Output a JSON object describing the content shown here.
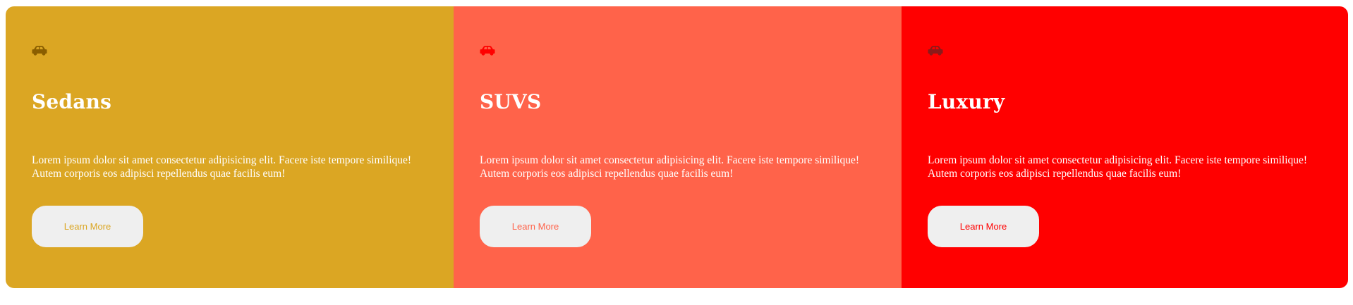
{
  "cards": [
    {
      "title": "Sedans",
      "description": "Lorem ipsum dolor sit amet consectetur adipisicing elit. Facere iste tempore similique! Autem corporis eos adipisci repellendus quae facilis eum!",
      "button_label": "Learn More",
      "icon": "car-icon",
      "background_color": "#DBA623",
      "icon_color": "#8A5E00",
      "button_text_color": "#DBA623"
    },
    {
      "title": "SUVS",
      "description": "Lorem ipsum dolor sit amet consectetur adipisicing elit. Facere iste tempore similique! Autem corporis eos adipisci repellendus quae facilis eum!",
      "button_label": "Learn More",
      "icon": "car-icon",
      "background_color": "#FF634A",
      "icon_color": "#FF0000",
      "button_text_color": "#FF634A"
    },
    {
      "title": "Luxury",
      "description": "Lorem ipsum dolor sit amet consectetur adipisicing elit. Facere iste tempore similique! Autem corporis eos adipisci repellendus quae facilis eum!",
      "button_label": "Learn More",
      "icon": "car-icon",
      "background_color": "#FF0000",
      "icon_color": "#8B1A1A",
      "button_text_color": "#FF0000"
    }
  ]
}
